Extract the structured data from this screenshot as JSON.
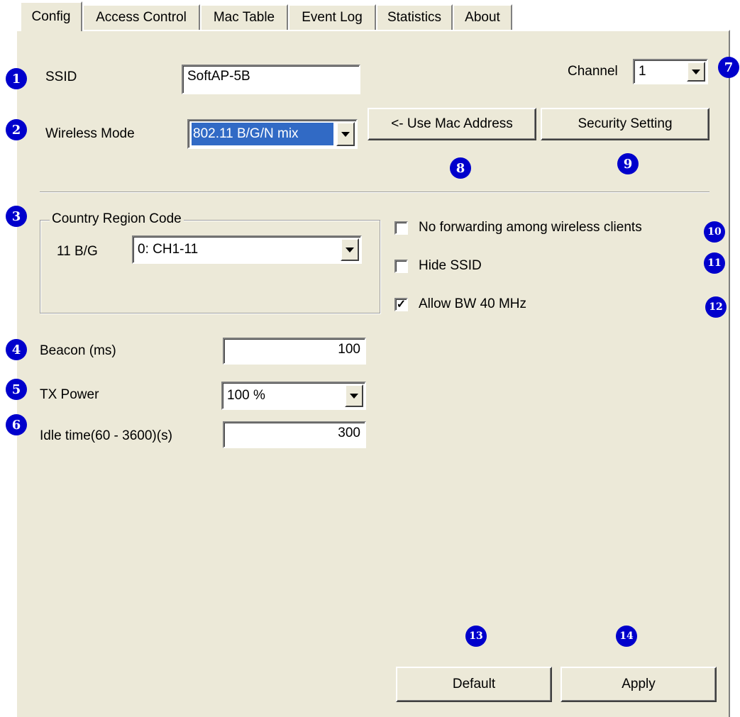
{
  "tabs": [
    {
      "label": "Config",
      "active": true
    },
    {
      "label": "Access Control"
    },
    {
      "label": "Mac Table"
    },
    {
      "label": "Event Log"
    },
    {
      "label": "Statistics"
    },
    {
      "label": "About"
    }
  ],
  "ssid": {
    "label": "SSID",
    "value": "SoftAP-5B"
  },
  "channel": {
    "label": "Channel",
    "value": "1"
  },
  "wireless_mode": {
    "label": "Wireless Mode",
    "value": "802.11 B/G/N mix"
  },
  "buttons": {
    "use_mac": "<- Use Mac Address",
    "security": "Security Setting",
    "default": "Default",
    "apply": "Apply"
  },
  "country_region": {
    "group_label": "Country Region Code",
    "band_label": "11 B/G",
    "value": "0: CH1-11"
  },
  "options": {
    "no_forwarding": {
      "label": "No forwarding among wireless clients",
      "checked": false
    },
    "hide_ssid": {
      "label": "Hide SSID",
      "checked": false
    },
    "allow_bw40": {
      "label": "Allow BW 40 MHz",
      "checked": true,
      "mark": "✓"
    }
  },
  "beacon": {
    "label": "Beacon (ms)",
    "value": "100"
  },
  "tx_power": {
    "label": "TX Power",
    "value": "100 %"
  },
  "idle_time": {
    "label": "Idle time(60 - 3600)(s)",
    "value": "300"
  },
  "callouts": [
    "1",
    "2",
    "3",
    "4",
    "5",
    "6",
    "7",
    "8",
    "9",
    "10",
    "11",
    "12",
    "13",
    "14"
  ],
  "colors": {
    "panel_bg": "#ece9d8",
    "badge": "#0000cc",
    "selection": "#316ac5"
  }
}
